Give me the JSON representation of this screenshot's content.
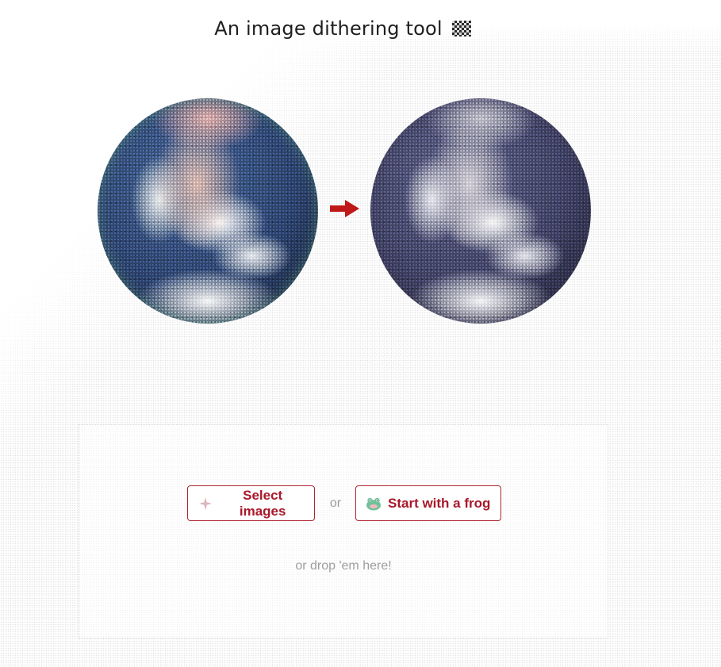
{
  "header": {
    "title": "An image dithering tool",
    "title_icon": "checkerboard-icon"
  },
  "hero": {
    "original_image": "earth-globe-original",
    "arrow_icon": "right-arrow-icon",
    "arrow_color": "#c01818",
    "dithered_image": "earth-globe-dithered"
  },
  "upload": {
    "select_button": {
      "label": "Select images",
      "icon": "sparkle-image-icon"
    },
    "separator": "or",
    "frog_button": {
      "label": "Start with a frog",
      "icon": "frog-icon"
    },
    "drop_hint": "or drop 'em here!"
  },
  "colors": {
    "accent": "#a8182a",
    "button_border": "#b02532",
    "muted_text": "#9a9a9a"
  }
}
